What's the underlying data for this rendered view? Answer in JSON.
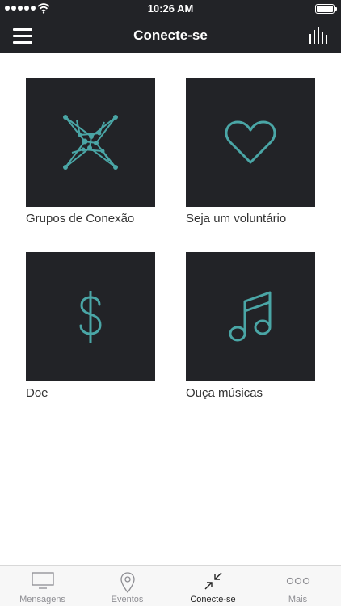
{
  "status_bar": {
    "time": "10:26 AM",
    "signal_icon": "signal-dots-icon",
    "wifi_icon": "wifi-icon",
    "battery_icon": "battery-icon"
  },
  "nav": {
    "title": "Conecte-se",
    "menu_icon": "hamburger-menu-icon",
    "right_icon": "audio-bars-icon"
  },
  "tiles": [
    {
      "label": "Grupos de Conexão",
      "icon": "network-star-icon"
    },
    {
      "label": "Seja um voluntário",
      "icon": "heart-icon"
    },
    {
      "label": "Doe",
      "icon": "dollar-icon"
    },
    {
      "label": "Ouça músicas",
      "icon": "music-note-icon"
    }
  ],
  "tabbar": {
    "items": [
      {
        "label": "Mensagens",
        "icon": "tv-icon",
        "active": false
      },
      {
        "label": "Eventos",
        "icon": "location-pin-icon",
        "active": false
      },
      {
        "label": "Conecte-se",
        "icon": "collapse-arrows-icon",
        "active": true
      },
      {
        "label": "Mais",
        "icon": "more-dots-icon",
        "active": false
      }
    ]
  },
  "colors": {
    "dark": "#222327",
    "accent": "#4aa6a6",
    "background": "#ffffff",
    "tab_inactive": "#8e8e93"
  }
}
